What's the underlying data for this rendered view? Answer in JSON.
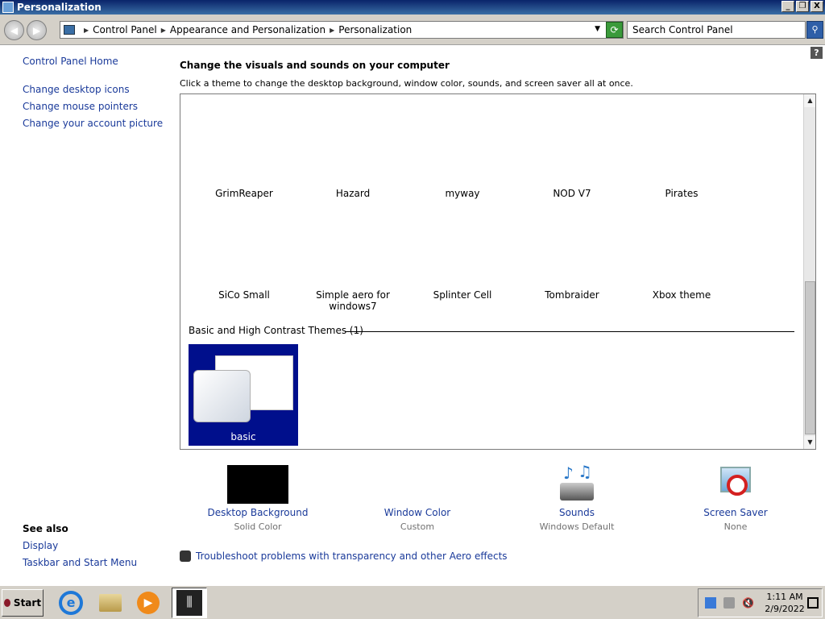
{
  "window": {
    "title": "Personalization",
    "controls": [
      "_",
      "❐",
      "X"
    ]
  },
  "addressbar": {
    "breadcrumbs": [
      "Control Panel",
      "Appearance and Personalization",
      "Personalization"
    ],
    "search_placeholder": "Search Control Panel"
  },
  "sidebar": {
    "home": "Control Panel Home",
    "links": [
      "Change desktop icons",
      "Change mouse pointers",
      "Change your account picture"
    ],
    "see_also_title": "See also",
    "see_also": [
      "Display",
      "Taskbar and Start Menu"
    ]
  },
  "main": {
    "heading": "Change the visuals and sounds on your computer",
    "subheading": "Click a theme to change the desktop background, window color, sounds, and screen saver all at once.",
    "themes_row1": [
      "GrimReaper",
      "Hazard",
      "myway",
      "NOD V7",
      "Pirates"
    ],
    "themes_row2": [
      "SiCo Small",
      "Simple aero for windows7",
      "Splinter Cell",
      "Tombraider",
      "Xbox theme"
    ],
    "group_title": "Basic and High Contrast Themes (1)",
    "basic_theme": "basic"
  },
  "options": [
    {
      "label": "Desktop Background",
      "value": "Solid Color"
    },
    {
      "label": "Window Color",
      "value": "Custom"
    },
    {
      "label": "Sounds",
      "value": "Windows Default"
    },
    {
      "label": "Screen Saver",
      "value": "None"
    }
  ],
  "troubleshoot": "Troubleshoot problems with transparency and other Aero effects",
  "taskbar": {
    "start": "Start",
    "time": "1:11 AM",
    "date": "2/9/2022"
  },
  "colors": {
    "link": "#1a3a9a",
    "basic_theme_bg": "#000f8c",
    "titlebar": "#0a246a"
  }
}
